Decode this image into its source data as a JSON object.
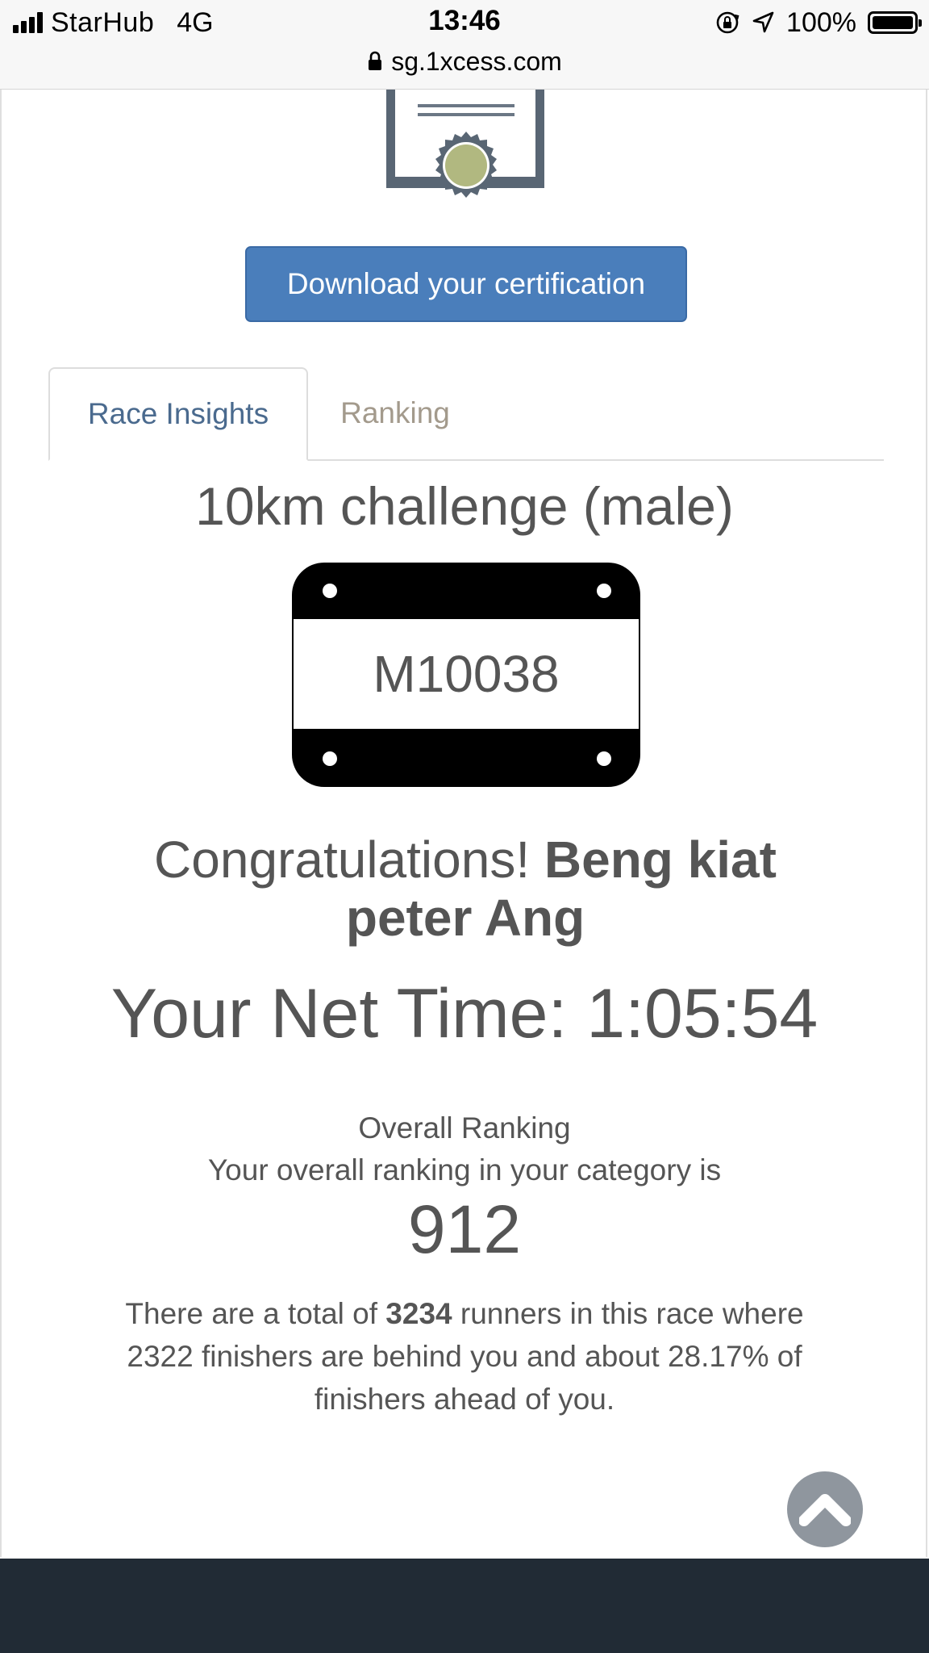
{
  "status_bar": {
    "carrier": "StarHub",
    "network": "4G",
    "time": "13:46",
    "battery": "100%",
    "icons": [
      "signal-icon",
      "rotation-lock-icon",
      "location-icon",
      "battery-icon"
    ]
  },
  "url_bar": {
    "url": "sg.1xcess.com",
    "icon": "lock-icon"
  },
  "certificate": {
    "icon": "certificate-icon",
    "download_label": "Download your certification"
  },
  "tabs": [
    {
      "label": "Race Insights",
      "active": true
    },
    {
      "label": "Ranking",
      "active": false
    }
  ],
  "race": {
    "title": "10km challenge (male)",
    "bib": "M10038"
  },
  "result": {
    "congrats_prefix": "Congratulations!",
    "runner_name": "Beng kiat peter Ang",
    "net_time": "Your Net Time: 1:05:54",
    "overall_heading": "Overall Ranking",
    "overall_sub": "Your overall ranking in your category is",
    "overall_rank": "912",
    "summary_prefix": "There are a total of",
    "total_runners": "3234",
    "summary_suffix": "runners in this race where 2322 finishers are behind you and about 28.17% of finishers ahead of you."
  },
  "scroll_top": {
    "icon": "chevron-up-icon"
  },
  "colors": {
    "primary_button": "#4a7ebb",
    "active_tab_text": "#4a6a8e",
    "inactive_tab_text": "#a39a8c",
    "body_text": "#555555",
    "footer": "#212b35",
    "scroll_button": "#8f969e"
  }
}
